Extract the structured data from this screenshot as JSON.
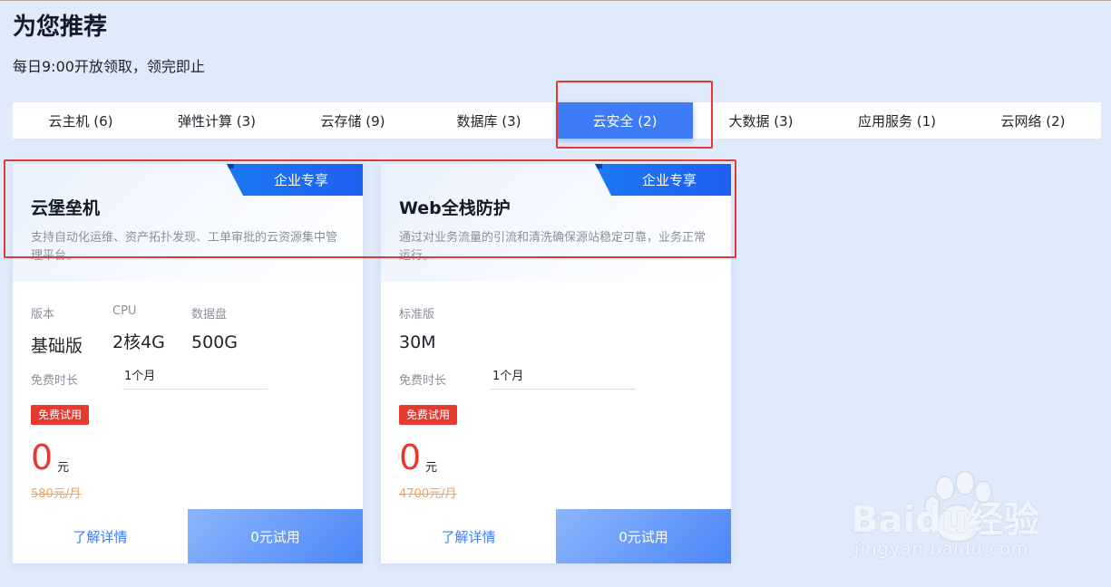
{
  "header": {
    "title": "为您推荐",
    "subtitle": "每日9:00开放领取，领完即止"
  },
  "tabs": [
    {
      "label": "云主机 (6)"
    },
    {
      "label": "弹性计算 (3)"
    },
    {
      "label": "云存储 (9)"
    },
    {
      "label": "数据库 (3)"
    },
    {
      "label": "云安全 (2)",
      "active": true
    },
    {
      "label": "大数据 (3)"
    },
    {
      "label": "应用服务 (1)"
    },
    {
      "label": "云网络 (2)"
    }
  ],
  "cards": [
    {
      "badge": "企业专享",
      "title": "云堡垒机",
      "description": "支持自动化运维、资产拓扑发现、工单审批的云资源集中管理平台。",
      "specs": [
        {
          "label": "版本",
          "value": "基础版"
        },
        {
          "label": "CPU",
          "value": "2核4G"
        },
        {
          "label": "数据盘",
          "value": "500G"
        }
      ],
      "duration_label": "免费时长",
      "duration_value": "1个月",
      "trial_badge": "免费试用",
      "price": "0",
      "price_unit": "元",
      "original_price": "580元/月",
      "detail_button": "了解详情",
      "trial_button": "0元试用"
    },
    {
      "badge": "企业专享",
      "title": "Web全栈防护",
      "description": "通过对业务流量的引流和清洗确保源站稳定可靠，业务正常运行。",
      "specs": [
        {
          "label": "标准版",
          "value": "30M"
        }
      ],
      "duration_label": "免费时长",
      "duration_value": "1个月",
      "trial_badge": "免费试用",
      "price": "0",
      "price_unit": "元",
      "original_price": "4700元/月",
      "detail_button": "了解详情",
      "trial_button": "0元试用"
    }
  ],
  "watermark": {
    "brand": "Baidu经验",
    "url": "jingyan.baidu.com"
  },
  "colors": {
    "accent": "#3d7bf7",
    "price_red": "#e6392f",
    "annotation_red": "#e43a35"
  }
}
